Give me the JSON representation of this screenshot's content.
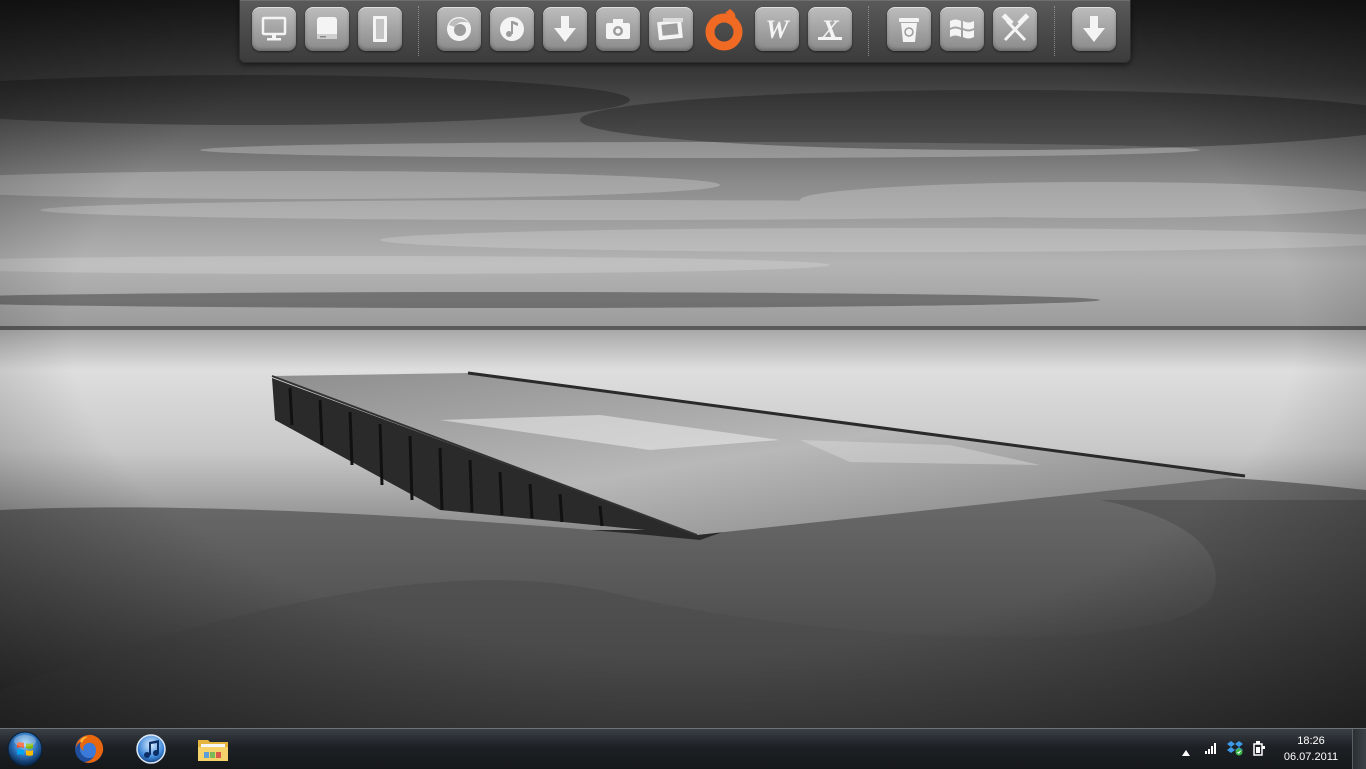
{
  "desktop": {
    "wallpaper": "black-and-white pier on beach long exposure"
  },
  "dock": {
    "groups": [
      {
        "items": [
          {
            "icon": "computer-icon"
          },
          {
            "icon": "drive-icon"
          },
          {
            "icon": "documents-icon"
          }
        ]
      },
      {
        "items": [
          {
            "icon": "firefox-icon"
          },
          {
            "icon": "music-player-icon"
          },
          {
            "icon": "download-icon"
          },
          {
            "icon": "camera-icon"
          },
          {
            "icon": "photo-viewer-icon"
          },
          {
            "icon": "origin-icon",
            "color": "#f06a24"
          },
          {
            "icon": "word-icon",
            "letter": "W"
          },
          {
            "icon": "excel-icon",
            "letter": "X"
          }
        ]
      },
      {
        "items": [
          {
            "icon": "recycle-bin-icon"
          },
          {
            "icon": "windows-icon"
          },
          {
            "icon": "tools-icon"
          }
        ]
      },
      {
        "items": [
          {
            "icon": "download-icon"
          }
        ]
      }
    ]
  },
  "taskbar": {
    "start_icon": "windows-start-orb-icon",
    "pinned_apps": [
      {
        "icon": "firefox-icon"
      },
      {
        "icon": "itunes-icon"
      },
      {
        "icon": "windows-explorer-icon"
      }
    ],
    "tray": {
      "icons": [
        "show-hidden-icons-icon",
        "network-signal-icon",
        "dropbox-icon",
        "power-icon"
      ]
    },
    "clock": {
      "time": "18:26",
      "date": "06.07.2011"
    }
  },
  "colors": {
    "origin_accent": "#f06a24",
    "taskbar_dark": "#15181a",
    "dock_gray": "#4a4a4a"
  }
}
